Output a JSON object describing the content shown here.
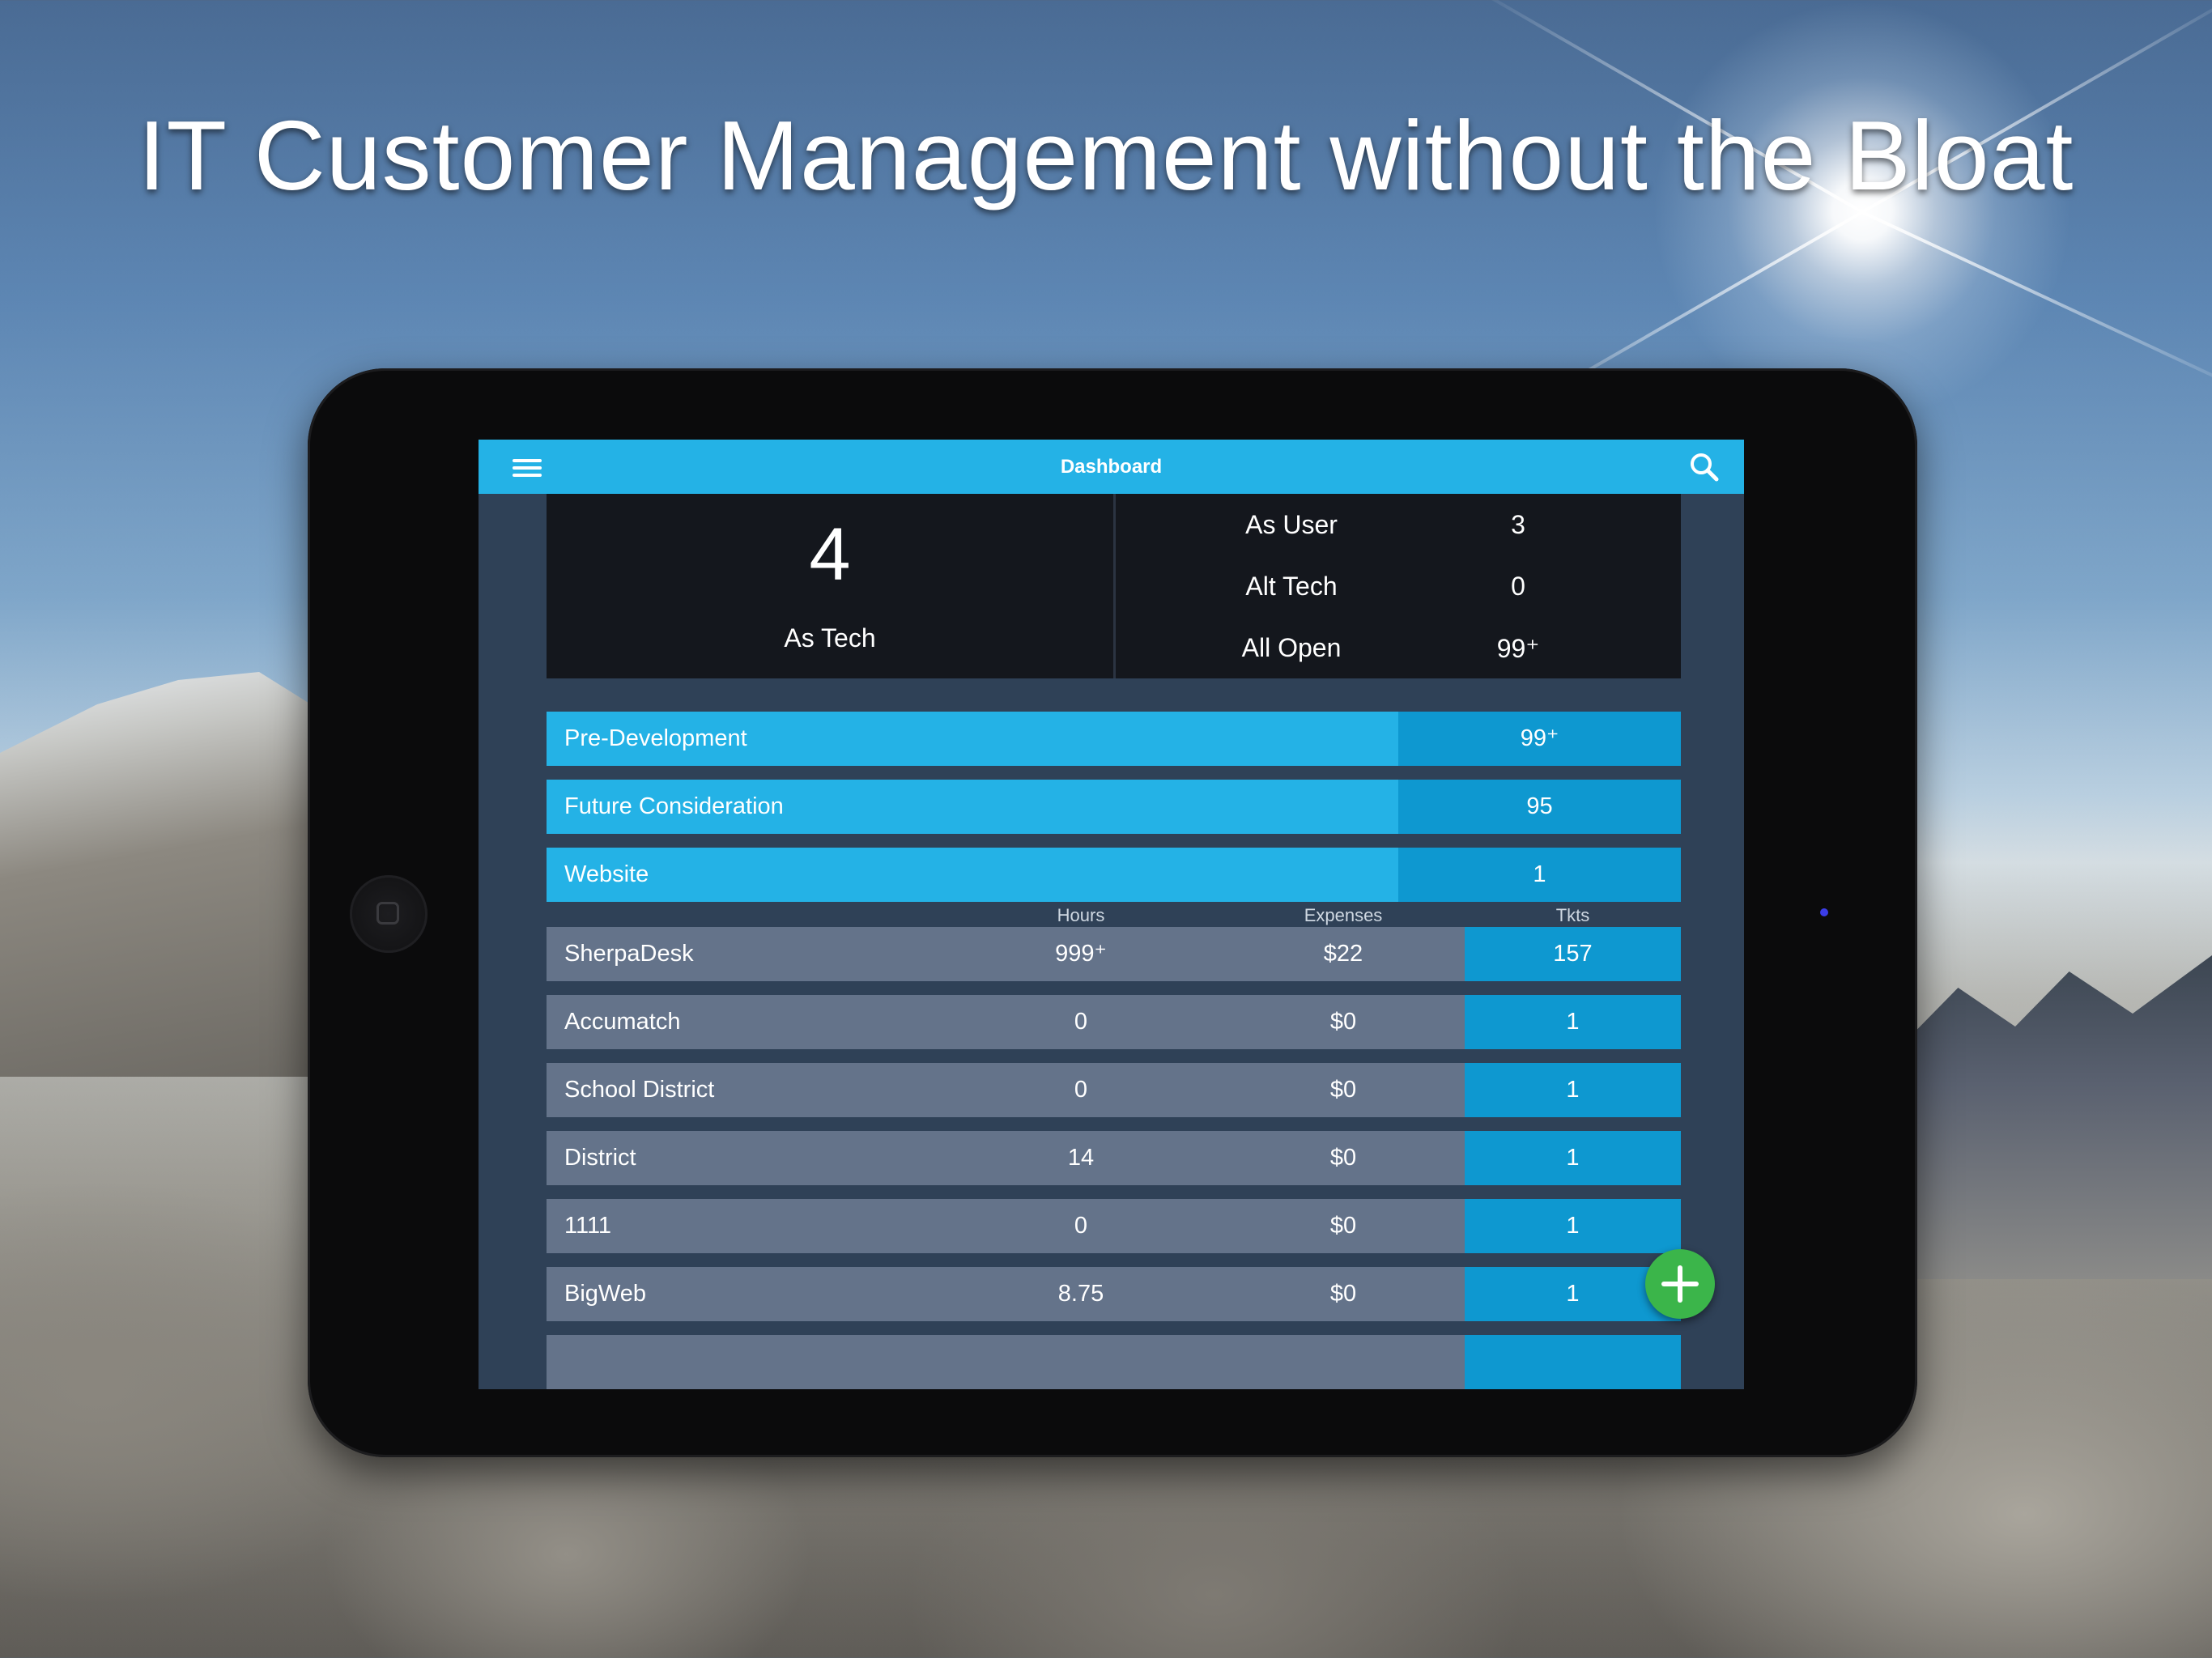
{
  "headline": "IT Customer Management without the Bloat",
  "app": {
    "title": "Dashboard",
    "stats": {
      "primary_value": "4",
      "primary_label": "As Tech",
      "rows": [
        {
          "label": "As User",
          "value": "3"
        },
        {
          "label": "Alt Tech",
          "value": "0"
        },
        {
          "label": "All Open",
          "value": "99⁺"
        }
      ]
    },
    "categories": [
      {
        "name": "Pre-Development",
        "count": "99⁺"
      },
      {
        "name": "Future Consideration",
        "count": "95"
      },
      {
        "name": "Website",
        "count": "1"
      }
    ],
    "table": {
      "headers": {
        "hours": "Hours",
        "expenses": "Expenses",
        "tickets": "Tkts"
      },
      "rows": [
        {
          "name": "SherpaDesk",
          "hours": "999⁺",
          "expenses": "$22",
          "tickets": "157"
        },
        {
          "name": "Accumatch",
          "hours": "0",
          "expenses": "$0",
          "tickets": "1"
        },
        {
          "name": "School District",
          "hours": "0",
          "expenses": "$0",
          "tickets": "1"
        },
        {
          "name": "District",
          "hours": "14",
          "expenses": "$0",
          "tickets": "1"
        },
        {
          "name": "1111",
          "hours": "0",
          "expenses": "$0",
          "tickets": "1"
        },
        {
          "name": "BigWeb",
          "hours": "8.75",
          "expenses": "$0",
          "tickets": "1"
        }
      ]
    }
  },
  "colors": {
    "topbar": "#24b2e6",
    "accent_dark": "#0e98d0",
    "screen_bg": "#2f4157",
    "row_bg": "#64738a",
    "fab": "#3bb54a"
  },
  "icons": {
    "menu": "hamburger-icon",
    "search": "search-icon",
    "add": "plus-icon"
  }
}
